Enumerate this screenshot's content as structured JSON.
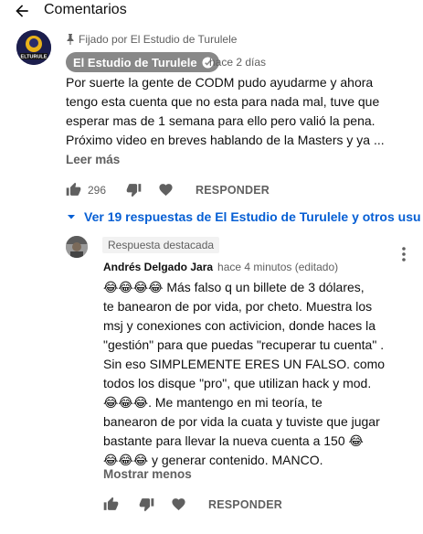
{
  "header": {
    "title": "Comentarios"
  },
  "pinned_comment": {
    "pinned_label": "Fijado por El Estudio de Turulele",
    "author": "El Estudio de Turulele",
    "avatar_text": "ELTURULE",
    "time": "hace 2 días",
    "text_lines": [
      "Por suerte la gente de CODM pudo ayudarme y ahora",
      "tengo esta cuenta que no esta para nada mal, tuve que",
      "esperar mas de 1 semana para ello pero valió la pena.",
      "Próximo video en breves hablando de la Masters y ya ..."
    ],
    "read_more": "Leer más",
    "likes": "296",
    "reply_label": "RESPONDER"
  },
  "view_replies": "Ver 19 respuestas de El Estudio de Turulele y otros usu",
  "featured_reply": {
    "badge": "Respuesta destacada",
    "author": "Andrés Delgado Jara",
    "meta": "hace 4 minutos (editado)",
    "text_lines": [
      "😂😂😂😂 Más falso q un billete de 3 dólares,",
      "te banearon de por vida, por cheto. Muestra los",
      "msj y conexiones con activicion, donde haces la",
      "\"gestión\" para que puedas \"recuperar tu cuenta\" .",
      "Sin eso SIMPLEMENTE ERES UN FALSO. como",
      "todos los disque \"pro\", que utilizan hack y mod.",
      "😂😂😂. Me mantengo en mi teoría, te",
      "banearon de por vida la cuata y tuviste que jugar",
      "bastante para llevar la nueva cuenta a 150 😂",
      "😂😂😂 y generar contenido. MANCO."
    ],
    "show_less": "Mostrar menos",
    "reply_label": "RESPONDER"
  },
  "colors": {
    "link_blue": "#065fd4",
    "chip_gray": "#888888",
    "secondary_text": "#606060"
  }
}
